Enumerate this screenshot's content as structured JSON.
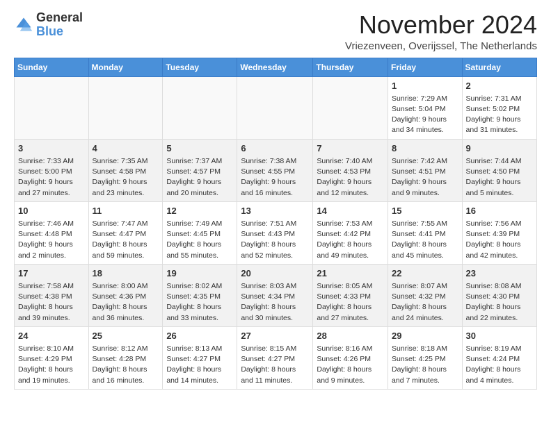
{
  "logo": {
    "general": "General",
    "blue": "Blue"
  },
  "header": {
    "title": "November 2024",
    "subtitle": "Vriezenveen, Overijssel, The Netherlands"
  },
  "weekdays": [
    "Sunday",
    "Monday",
    "Tuesday",
    "Wednesday",
    "Thursday",
    "Friday",
    "Saturday"
  ],
  "weeks": [
    [
      {
        "day": "",
        "info": ""
      },
      {
        "day": "",
        "info": ""
      },
      {
        "day": "",
        "info": ""
      },
      {
        "day": "",
        "info": ""
      },
      {
        "day": "",
        "info": ""
      },
      {
        "day": "1",
        "info": "Sunrise: 7:29 AM\nSunset: 5:04 PM\nDaylight: 9 hours and 34 minutes."
      },
      {
        "day": "2",
        "info": "Sunrise: 7:31 AM\nSunset: 5:02 PM\nDaylight: 9 hours and 31 minutes."
      }
    ],
    [
      {
        "day": "3",
        "info": "Sunrise: 7:33 AM\nSunset: 5:00 PM\nDaylight: 9 hours and 27 minutes."
      },
      {
        "day": "4",
        "info": "Sunrise: 7:35 AM\nSunset: 4:58 PM\nDaylight: 9 hours and 23 minutes."
      },
      {
        "day": "5",
        "info": "Sunrise: 7:37 AM\nSunset: 4:57 PM\nDaylight: 9 hours and 20 minutes."
      },
      {
        "day": "6",
        "info": "Sunrise: 7:38 AM\nSunset: 4:55 PM\nDaylight: 9 hours and 16 minutes."
      },
      {
        "day": "7",
        "info": "Sunrise: 7:40 AM\nSunset: 4:53 PM\nDaylight: 9 hours and 12 minutes."
      },
      {
        "day": "8",
        "info": "Sunrise: 7:42 AM\nSunset: 4:51 PM\nDaylight: 9 hours and 9 minutes."
      },
      {
        "day": "9",
        "info": "Sunrise: 7:44 AM\nSunset: 4:50 PM\nDaylight: 9 hours and 5 minutes."
      }
    ],
    [
      {
        "day": "10",
        "info": "Sunrise: 7:46 AM\nSunset: 4:48 PM\nDaylight: 9 hours and 2 minutes."
      },
      {
        "day": "11",
        "info": "Sunrise: 7:47 AM\nSunset: 4:47 PM\nDaylight: 8 hours and 59 minutes."
      },
      {
        "day": "12",
        "info": "Sunrise: 7:49 AM\nSunset: 4:45 PM\nDaylight: 8 hours and 55 minutes."
      },
      {
        "day": "13",
        "info": "Sunrise: 7:51 AM\nSunset: 4:43 PM\nDaylight: 8 hours and 52 minutes."
      },
      {
        "day": "14",
        "info": "Sunrise: 7:53 AM\nSunset: 4:42 PM\nDaylight: 8 hours and 49 minutes."
      },
      {
        "day": "15",
        "info": "Sunrise: 7:55 AM\nSunset: 4:41 PM\nDaylight: 8 hours and 45 minutes."
      },
      {
        "day": "16",
        "info": "Sunrise: 7:56 AM\nSunset: 4:39 PM\nDaylight: 8 hours and 42 minutes."
      }
    ],
    [
      {
        "day": "17",
        "info": "Sunrise: 7:58 AM\nSunset: 4:38 PM\nDaylight: 8 hours and 39 minutes."
      },
      {
        "day": "18",
        "info": "Sunrise: 8:00 AM\nSunset: 4:36 PM\nDaylight: 8 hours and 36 minutes."
      },
      {
        "day": "19",
        "info": "Sunrise: 8:02 AM\nSunset: 4:35 PM\nDaylight: 8 hours and 33 minutes."
      },
      {
        "day": "20",
        "info": "Sunrise: 8:03 AM\nSunset: 4:34 PM\nDaylight: 8 hours and 30 minutes."
      },
      {
        "day": "21",
        "info": "Sunrise: 8:05 AM\nSunset: 4:33 PM\nDaylight: 8 hours and 27 minutes."
      },
      {
        "day": "22",
        "info": "Sunrise: 8:07 AM\nSunset: 4:32 PM\nDaylight: 8 hours and 24 minutes."
      },
      {
        "day": "23",
        "info": "Sunrise: 8:08 AM\nSunset: 4:30 PM\nDaylight: 8 hours and 22 minutes."
      }
    ],
    [
      {
        "day": "24",
        "info": "Sunrise: 8:10 AM\nSunset: 4:29 PM\nDaylight: 8 hours and 19 minutes."
      },
      {
        "day": "25",
        "info": "Sunrise: 8:12 AM\nSunset: 4:28 PM\nDaylight: 8 hours and 16 minutes."
      },
      {
        "day": "26",
        "info": "Sunrise: 8:13 AM\nSunset: 4:27 PM\nDaylight: 8 hours and 14 minutes."
      },
      {
        "day": "27",
        "info": "Sunrise: 8:15 AM\nSunset: 4:27 PM\nDaylight: 8 hours and 11 minutes."
      },
      {
        "day": "28",
        "info": "Sunrise: 8:16 AM\nSunset: 4:26 PM\nDaylight: 8 hours and 9 minutes."
      },
      {
        "day": "29",
        "info": "Sunrise: 8:18 AM\nSunset: 4:25 PM\nDaylight: 8 hours and 7 minutes."
      },
      {
        "day": "30",
        "info": "Sunrise: 8:19 AM\nSunset: 4:24 PM\nDaylight: 8 hours and 4 minutes."
      }
    ]
  ]
}
